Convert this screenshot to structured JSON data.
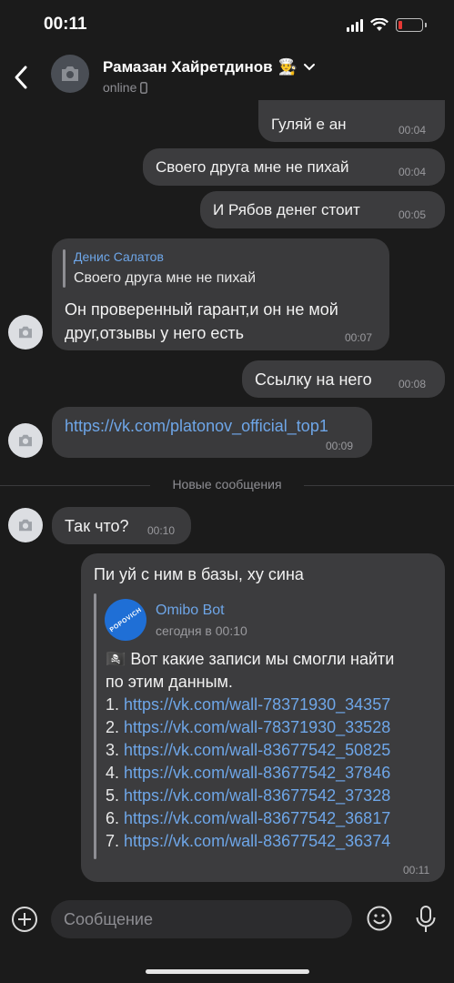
{
  "status": {
    "time": "00:11"
  },
  "header": {
    "name": "Рамазан Хайретдинов",
    "name_emoji": "👨‍🍳",
    "presence": "online"
  },
  "messages": [
    {
      "dir": "out",
      "text": "Гуляй е   ан",
      "time": "00:04"
    },
    {
      "dir": "out",
      "text": "Своего друга мне не пихай",
      "time": "00:04"
    },
    {
      "dir": "out",
      "text": "И Рябов денег стоит",
      "time": "00:05"
    },
    {
      "dir": "in",
      "reply_author": "Денис Салатов",
      "reply_text": "Своего друга мне не пихай",
      "text_line1": "Он проверенный гарант,и он не мой",
      "text_line2": "друг,отзывы у него есть",
      "time": "00:07"
    },
    {
      "dir": "out",
      "text": "Ссылку на него",
      "time": "00:08"
    },
    {
      "dir": "in",
      "link": "https://vk.com/platonov_official_top1",
      "time": "00:09"
    },
    {
      "dir": "in",
      "text": "Так что?",
      "time": "00:10"
    },
    {
      "dir": "out",
      "text": "Пи    уй с ним в базы, ху       сина",
      "time": "00:11",
      "forward": {
        "author": "Omibo Bot",
        "date": "сегодня в 00:10",
        "logo_text": "POPOVICH",
        "intro_line1": "🏴‍☠️ Вот какие записи мы смогли найти",
        "intro_line2": "по этим данным.",
        "links": [
          {
            "n": "1.",
            "url": "https://vk.com/wall-78371930_34357"
          },
          {
            "n": "2.",
            "url": "https://vk.com/wall-78371930_33528"
          },
          {
            "n": "3.",
            "url": "https://vk.com/wall-83677542_50825"
          },
          {
            "n": "4.",
            "url": "https://vk.com/wall-83677542_37846"
          },
          {
            "n": "5.",
            "url": "https://vk.com/wall-83677542_37328"
          },
          {
            "n": "6.",
            "url": "https://vk.com/wall-83677542_36817"
          },
          {
            "n": "7.",
            "url": "https://vk.com/wall-83677542_36374"
          }
        ]
      }
    }
  ],
  "divider_label": "Новые сообщения",
  "composer": {
    "placeholder": "Сообщение"
  },
  "colors": {
    "background": "#1b1b1b",
    "bubble": "#3a3a3c",
    "link": "#6ea6e8",
    "reply_author": "#6ea6e8"
  }
}
